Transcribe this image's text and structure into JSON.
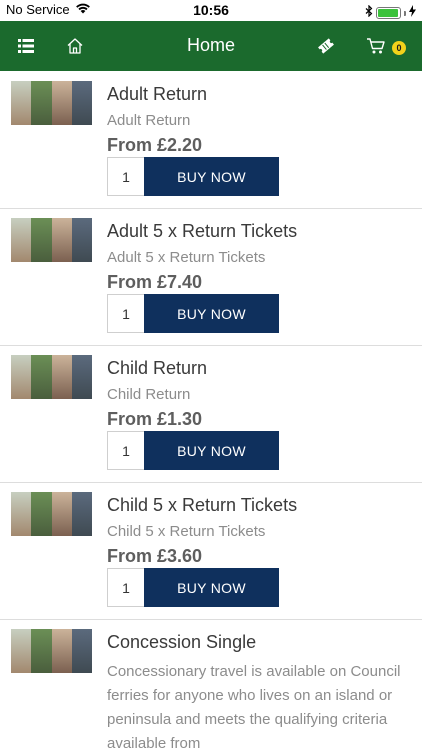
{
  "status_bar": {
    "carrier": "No Service",
    "time": "10:56",
    "battery_level": 0.95
  },
  "nav": {
    "title": "Home",
    "cart_count": "0",
    "color": "#1b6a2d"
  },
  "colors": {
    "buy_button": "#0f305d",
    "badge": "#f2d21b"
  },
  "products": [
    {
      "title": "Adult Return",
      "subtitle": "Adult Return",
      "price": "From £2.20",
      "quantity": "1",
      "button_label": "BUY NOW"
    },
    {
      "title": "Adult 5 x Return Tickets",
      "subtitle": "Adult 5 x Return Tickets",
      "price": "From £7.40",
      "quantity": "1",
      "button_label": "BUY NOW"
    },
    {
      "title": "Child Return",
      "subtitle": "Child Return",
      "price": "From £1.30",
      "quantity": "1",
      "button_label": "BUY NOW"
    },
    {
      "title": "Child 5 x Return Tickets",
      "subtitle": "Child 5 x Return Tickets",
      "price": "From £3.60",
      "quantity": "1",
      "button_label": "BUY NOW"
    },
    {
      "title": "Concession Single",
      "description": "Concessionary travel is available on Council ferries for anyone who lives on an island or peninsula and meets the qualifying criteria available from"
    }
  ],
  "icons": [
    "wifi-icon",
    "bluetooth-icon",
    "list-icon",
    "home-icon",
    "ticket-icon",
    "cart-icon"
  ]
}
